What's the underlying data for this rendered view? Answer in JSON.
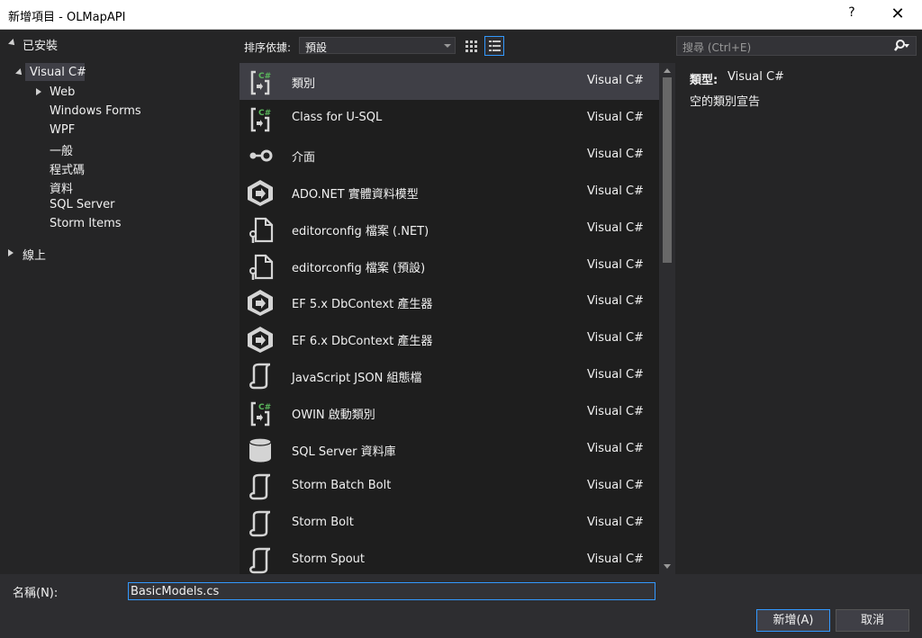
{
  "window": {
    "title": "新增項目 - OLMapAPI",
    "help": "?",
    "close": "✕"
  },
  "tree": {
    "installed": "已安裝",
    "visual_csharp": "Visual C#",
    "children": [
      "Web",
      "Windows Forms",
      "WPF",
      "一般",
      "程式碼",
      "資料",
      "SQL Server",
      "Storm Items"
    ],
    "online": "線上"
  },
  "sort": {
    "label": "排序依據:",
    "value": "預設"
  },
  "search": {
    "placeholder": "搜尋 (Ctrl+E)"
  },
  "templates": [
    {
      "name": "類別",
      "lang": "Visual C#",
      "icon": "class-icon"
    },
    {
      "name": "Class for U-SQL",
      "lang": "Visual C#",
      "icon": "class-icon"
    },
    {
      "name": "介面",
      "lang": "Visual C#",
      "icon": "interface-icon"
    },
    {
      "name": "ADO.NET 實體資料模型",
      "lang": "Visual C#",
      "icon": "entity-model-icon"
    },
    {
      "name": "editorconfig 檔案 (.NET)",
      "lang": "Visual C#",
      "icon": "config-file-icon"
    },
    {
      "name": "editorconfig 檔案 (預設)",
      "lang": "Visual C#",
      "icon": "config-file-icon"
    },
    {
      "name": "EF 5.x DbContext 產生器",
      "lang": "Visual C#",
      "icon": "entity-model-icon"
    },
    {
      "name": "EF 6.x DbContext 產生器",
      "lang": "Visual C#",
      "icon": "entity-model-icon"
    },
    {
      "name": "JavaScript JSON 組態檔",
      "lang": "Visual C#",
      "icon": "scroll-icon"
    },
    {
      "name": "OWIN 啟動類別",
      "lang": "Visual C#",
      "icon": "class-icon"
    },
    {
      "name": "SQL Server 資料庫",
      "lang": "Visual C#",
      "icon": "database-icon"
    },
    {
      "name": "Storm Batch Bolt",
      "lang": "Visual C#",
      "icon": "scroll-icon"
    },
    {
      "name": "Storm Bolt",
      "lang": "Visual C#",
      "icon": "scroll-icon"
    },
    {
      "name": "Storm Spout",
      "lang": "Visual C#",
      "icon": "scroll-icon"
    }
  ],
  "detail": {
    "type_label": "類型:",
    "type_value": "Visual C#",
    "description": "空的類別宣告"
  },
  "name_field": {
    "label": "名稱(N):",
    "value": "BasicModels.cs"
  },
  "buttons": {
    "add": "新增(A)",
    "cancel": "取消"
  },
  "colors": {
    "accent": "#3399ff",
    "csharp_badge": "#5bb85d",
    "background": "#252526",
    "list_bg": "#1e1e1e"
  }
}
